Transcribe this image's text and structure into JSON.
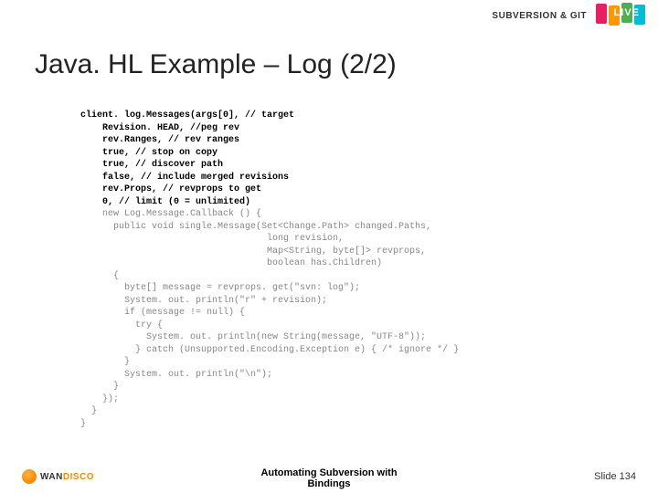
{
  "header": {
    "brand": "SUBVERSION & GIT",
    "badge_text": "LIVE"
  },
  "title": "Java. HL Example – Log (2/2)",
  "code_bold": "client. log.Messages(args[0], // target\n    Revision. HEAD, //peg rev\n    rev.Ranges, // rev ranges\n    true, // stop on copy\n    true, // discover path\n    false, // include merged revisions\n    rev.Props, // revprops to get\n    0, // limit (0 = unlimited)",
  "code_rest": "\n    new Log.Message.Callback () {\n      public void single.Message(Set<Change.Path> changed.Paths,\n                                  long revision,\n                                  Map<String, byte[]> revprops,\n                                  boolean has.Children)\n      {\n        byte[] message = revprops. get(\"svn: log\");\n        System. out. println(\"r\" + revision);\n        if (message != null) {\n          try {\n            System. out. println(new String(message, \"UTF-8\"));\n          } catch (Unsupported.Encoding.Exception e) { /* ignore */ }\n        }\n        System. out. println(\"\\n\");\n      }\n    });\n  }\n}",
  "footer": {
    "caption_line1": "Automating Subversion with",
    "caption_line2": "Bindings",
    "slide": "Slide 134",
    "logo_wan": "WAN",
    "logo_disco": "DISCO"
  }
}
